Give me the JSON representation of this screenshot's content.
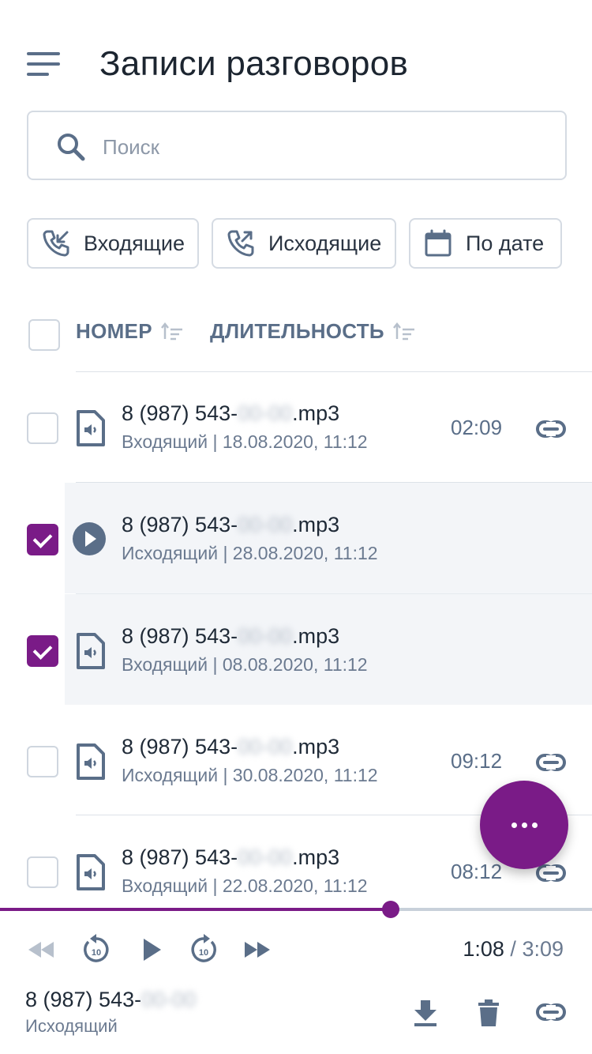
{
  "header": {
    "title": "Записи разговоров",
    "menu_icon": "hamburger-menu-icon"
  },
  "search": {
    "placeholder": "Поиск",
    "value": ""
  },
  "filters": [
    {
      "label": "Входящие",
      "icon": "incoming-call-icon"
    },
    {
      "label": "Исходящие",
      "icon": "outgoing-call-icon"
    },
    {
      "label": "По дате",
      "icon": "calendar-icon"
    }
  ],
  "columns": {
    "number": "НОМЕР",
    "duration": "ДЛИТЕЛЬНОСТЬ"
  },
  "recordings": [
    {
      "number": "8 (987) 543-",
      "hidden": "00-00",
      "ext": ".mp3",
      "meta": "Входящий  | 18.08.2020, 11:12",
      "duration": "02:09",
      "checked": false,
      "playing": false
    },
    {
      "number": "8 (987) 543-",
      "hidden": "00-00",
      "ext": ".mp3",
      "meta": "Исходящий | 28.08.2020, 11:12",
      "duration": "",
      "checked": true,
      "playing": true
    },
    {
      "number": "8 (987) 543-",
      "hidden": "00-00",
      "ext": ".mp3",
      "meta": "Входящий | 08.08.2020, 11:12",
      "duration": "",
      "checked": true,
      "playing": false
    },
    {
      "number": "8 (987) 543-",
      "hidden": "00-00",
      "ext": ".mp3",
      "meta": "Исходящий | 30.08.2020, 11:12",
      "duration": "09:12",
      "checked": false,
      "playing": false
    },
    {
      "number": "8 (987) 543-",
      "hidden": "00-00",
      "ext": ".mp3",
      "meta": "Входящий | 22.08.2020, 11:12",
      "duration": "08:12",
      "checked": false,
      "playing": false
    }
  ],
  "player": {
    "current": "1:08",
    "separator": " / ",
    "total": "3:09",
    "progress": 0.66,
    "number": "8 (987) 543-",
    "hidden": "00-00",
    "type": "Исходящий",
    "rewind_seconds": "10",
    "forward_seconds": "10"
  },
  "colors": {
    "accent": "#7a1b87",
    "icon": "#5a6e88",
    "text": "#1f2a37",
    "muted": "#6b7a90"
  }
}
